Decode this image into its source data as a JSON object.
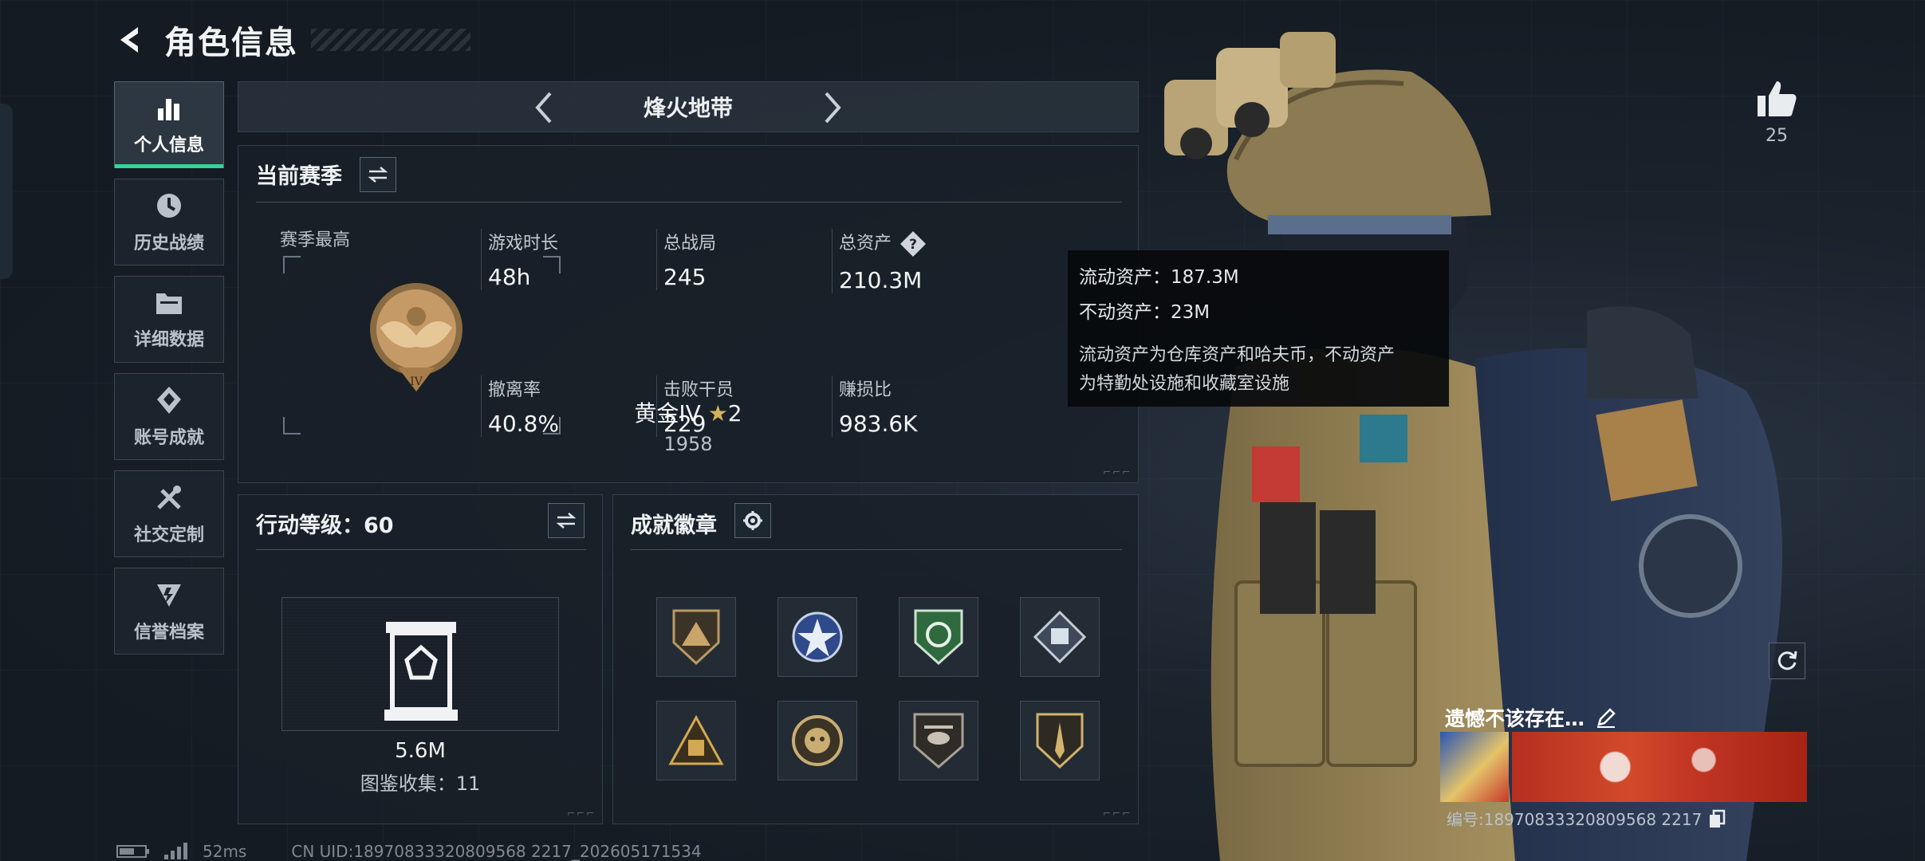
{
  "header": {
    "title": "角色信息"
  },
  "sidebar": {
    "items": [
      {
        "label": "个人信息",
        "icon": "bar-chart-icon",
        "active": true
      },
      {
        "label": "历史战绩",
        "icon": "history-clock-icon"
      },
      {
        "label": "详细数据",
        "icon": "folder-icon"
      },
      {
        "label": "账号成就",
        "icon": "achievement-icon"
      },
      {
        "label": "社交定制",
        "icon": "tools-icon"
      },
      {
        "label": "信誉档案",
        "icon": "reputation-icon"
      }
    ]
  },
  "map": {
    "name": "烽火地带"
  },
  "season": {
    "title": "当前赛季",
    "subtitle": "赛季最高",
    "rank_name": "黄金IV",
    "rank_stars": "2",
    "rank_score": "1958",
    "stats": [
      {
        "label": "游戏时长",
        "value": "48h"
      },
      {
        "label": "总战局",
        "value": "245"
      },
      {
        "label": "总资产",
        "value": "210.3M"
      },
      {
        "label": "撤离率",
        "value": "40.8%"
      },
      {
        "label": "击败干员",
        "value": "229"
      },
      {
        "label": "赚损比",
        "value": "983.6K"
      }
    ]
  },
  "tooltip": {
    "line1": "流动资产：187.3M",
    "line2": "不动资产：23M",
    "desc1": "流动资产为仓库资产和哈夫币，不动资产",
    "desc2": "为特勤处设施和收藏室设施"
  },
  "action": {
    "title": "行动等级：60",
    "value": "5.6M",
    "collection": "图鉴收集：11"
  },
  "achievements": {
    "title": "成就徽章",
    "badges": [
      "badge-mountain",
      "badge-star-shield",
      "badge-green-crest",
      "badge-diamond-flag",
      "badge-triangle-fist",
      "badge-round-mask",
      "badge-helicopter",
      "badge-blade-shield"
    ]
  },
  "status": {
    "ping": "52ms",
    "uid": "CN UID:18970833320809568 2217_202605171534"
  },
  "profile": {
    "likes": "25",
    "name": "遗憾不该存在…",
    "id": "编号:18970833320809568 2217"
  },
  "colors": {
    "accent": "#37d49a",
    "panel": "#18202a"
  }
}
